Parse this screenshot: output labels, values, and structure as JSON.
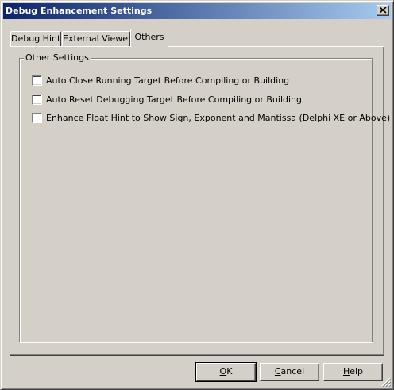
{
  "window": {
    "title": "Debug Enhancement Settings",
    "close_icon": "close-icon"
  },
  "tabs": [
    {
      "label": "Debug Hint",
      "active": false
    },
    {
      "label": "External Viewer",
      "active": false
    },
    {
      "label": "Others",
      "active": true
    }
  ],
  "other_settings": {
    "legend": "Other Settings",
    "options": [
      {
        "label": "Auto Close Running Target Before Compiling or Building",
        "checked": false
      },
      {
        "label": "Auto Reset Debugging Target Before Compiling or Building",
        "checked": false
      },
      {
        "label": "Enhance Float Hint to Show Sign, Exponent and Mantissa (Delphi XE or Above)",
        "checked": false
      }
    ]
  },
  "buttons": {
    "ok": {
      "mnemonic": "O",
      "rest": "K"
    },
    "cancel": {
      "mnemonic": "C",
      "rest": "ancel"
    },
    "help": {
      "mnemonic": "H",
      "rest": "elp"
    }
  },
  "colors": {
    "face": "#d4d0c8",
    "title_start": "#0a246a",
    "title_end": "#a6caf0"
  }
}
